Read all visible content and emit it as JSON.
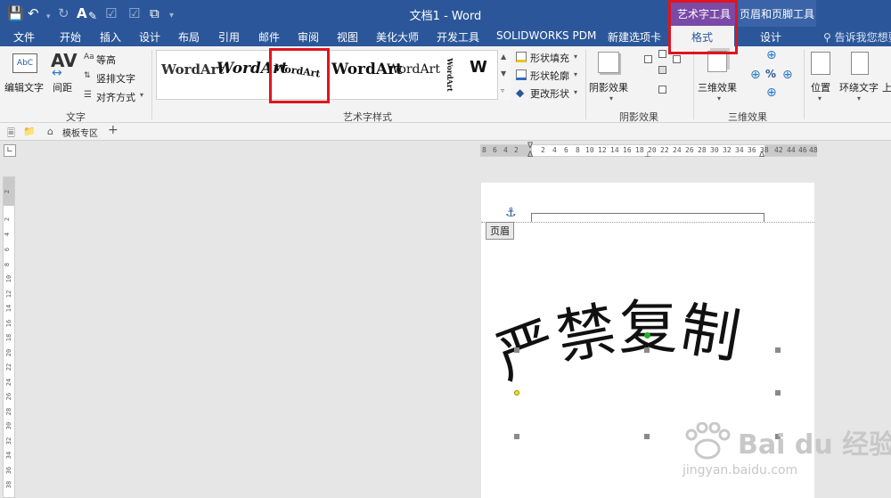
{
  "titlebar": {
    "title": "文档1 - Word",
    "context_tab_art": "艺术字工具",
    "context_tab_header": "页眉和页脚工具"
  },
  "tabs": [
    "文件",
    "开始",
    "插入",
    "设计",
    "布局",
    "引用",
    "邮件",
    "审阅",
    "视图",
    "美化大师",
    "开发工具",
    "SOLIDWORKS PDM",
    "新建选项卡",
    "格式",
    "设计"
  ],
  "tell_me": "告诉我您想要",
  "ribbon": {
    "text_group": {
      "edit_text": "编辑文字",
      "spacing": "间距",
      "equal_height": "等高",
      "vertical_text": "竖排文字",
      "align": "对齐方式",
      "label": "文字"
    },
    "wordart_styles": {
      "items": [
        "WordArt",
        "WordArt",
        "WordArt",
        "WordArt",
        "WordArt",
        "WordArt",
        "W"
      ],
      "fill": "形状填充",
      "outline": "形状轮廓",
      "change_shape": "更改形状",
      "label": "艺术字样式"
    },
    "shadow": {
      "button": "阴影效果",
      "label": "阴影效果"
    },
    "three_d": {
      "button": "三维效果",
      "label": "三维效果"
    },
    "arrange": {
      "position": "位置",
      "wrap": "环绕文字",
      "more": "上"
    }
  },
  "docstrip": {
    "label": "模板专区"
  },
  "ruler": {
    "ticks": [
      "8",
      "6",
      "4",
      "2",
      "",
      "2",
      "4",
      "6",
      "8",
      "10",
      "12",
      "14",
      "16",
      "18",
      "20",
      "22",
      "24",
      "26",
      "28",
      "30",
      "32",
      "34",
      "36",
      "38",
      "",
      "42",
      "44",
      "46",
      "48"
    ],
    "vticks": [
      "2",
      "",
      "2",
      "4",
      "6",
      "8",
      "10",
      "12",
      "14",
      "16",
      "18",
      "20",
      "22",
      "24",
      "26",
      "28",
      "30",
      "32",
      "34",
      "36",
      "38",
      "40",
      "42"
    ]
  },
  "page": {
    "header_tag": "页眉",
    "wordart_text": "严禁复制"
  },
  "watermark": {
    "brand": "Bai du 经验",
    "url": "jingyan.baidu.com"
  }
}
